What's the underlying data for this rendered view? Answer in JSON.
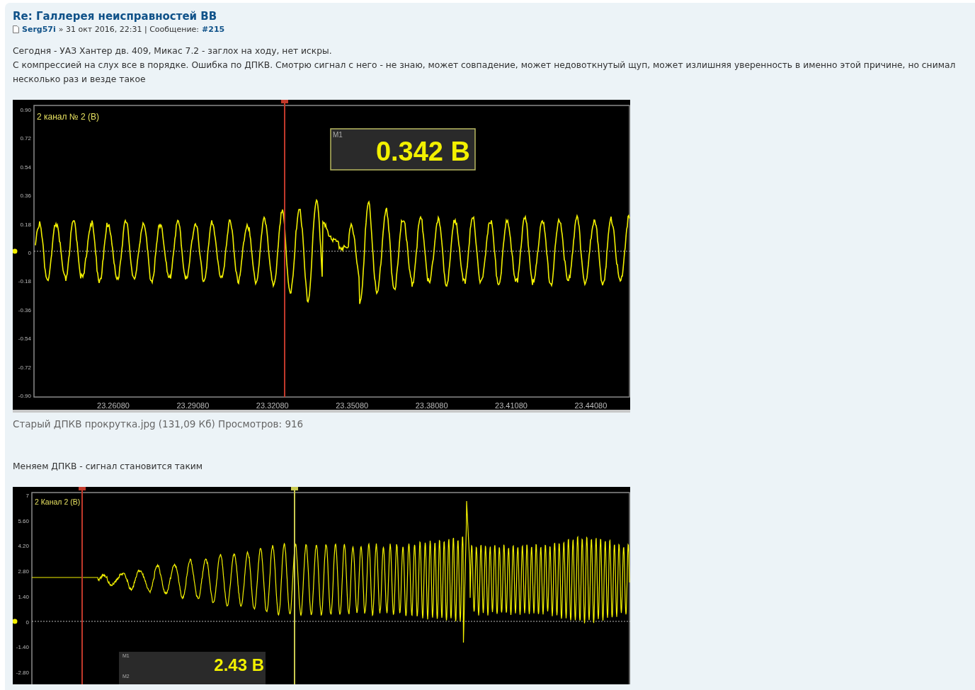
{
  "post": {
    "title": "Re: Галлерея неисправностей ВВ",
    "author": "Serg57i",
    "meta": "» 31 окт 2016, 22:31 | Сообщение:",
    "number": "#215"
  },
  "blocks": [
    {
      "kind": "text",
      "text": "Сегодня - УАЗ Хантер дв. 409, Микас 7.2 - заглох на ходу, нет искры."
    },
    {
      "kind": "text",
      "text": "С компрессией на слух все в порядке. Ошибка по ДПКВ. Смотрю сигнал с него - не знаю, может совпадение, может недовоткнутый щуп, может излишняя уверенность в именно этой причине, но снимал несколько раз и везде такое"
    },
    {
      "kind": "scope",
      "channel_label": "2 канал № 2 (В)",
      "y_labels": [
        "0.90",
        "0.72",
        "0.54",
        "0.36",
        "0.18",
        "0",
        "-0.18",
        "-0.36",
        "-0.54",
        "-0.72",
        "-0.90"
      ],
      "x_labels": [
        "23.26080",
        "23.29080",
        "23.32080",
        "23.35080",
        "23.38080",
        "23.41080",
        "23.44080"
      ],
      "cursors": [
        {
          "color": "#c0392b"
        }
      ],
      "markers": [
        {
          "label": "M1",
          "reading": "0.342 В"
        }
      ]
    },
    {
      "kind": "caption",
      "text": "Старый ДПКВ прокрутка.jpg (131,09 Кб) Просмотров: 916"
    },
    {
      "kind": "text",
      "text": "Меняем ДПКВ - сигнал становится таким"
    },
    {
      "kind": "scope",
      "channel_label": "2 Канал 2 (В)",
      "y_labels": [
        "7",
        "5.60",
        "4.20",
        "2.80",
        "1.40",
        "0",
        "-1.40",
        "-2.80"
      ],
      "cursors": [
        {
          "color": "#c0392b"
        },
        {
          "color": "#c8c850"
        }
      ],
      "markers": [
        {
          "label": "M1",
          "reading": "2.43 В"
        },
        {
          "label": "M2"
        }
      ]
    }
  ]
}
